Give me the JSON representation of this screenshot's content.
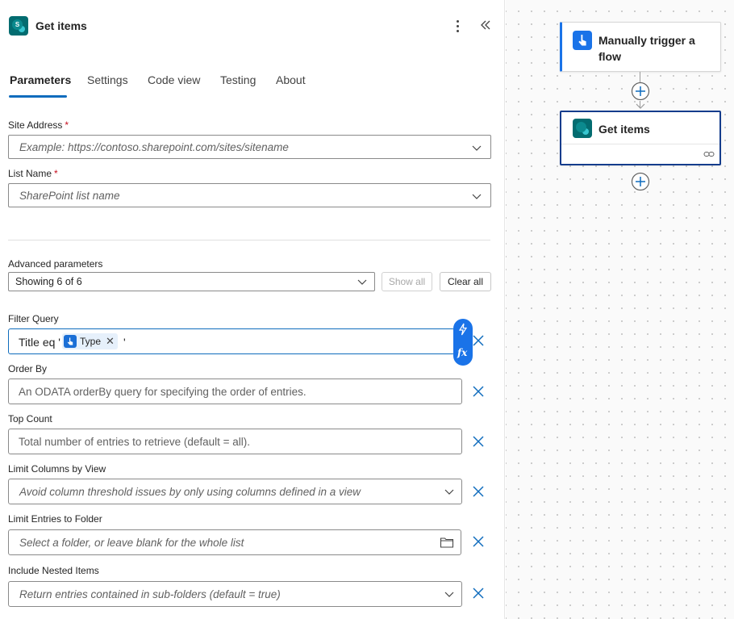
{
  "panel": {
    "title": "Get items",
    "tabs": [
      {
        "label": "Parameters",
        "active": true
      },
      {
        "label": "Settings",
        "active": false
      },
      {
        "label": "Code view",
        "active": false
      },
      {
        "label": "Testing",
        "active": false
      },
      {
        "label": "About",
        "active": false
      }
    ]
  },
  "fields": {
    "site_address": {
      "label": "Site Address",
      "required_mark": "*",
      "placeholder": "Example: https://contoso.sharepoint.com/sites/sitename"
    },
    "list_name": {
      "label": "List Name",
      "required_mark": "*",
      "placeholder": "SharePoint list name"
    }
  },
  "advanced": {
    "label": "Advanced parameters",
    "selected": "Showing 6 of 6",
    "show_all": "Show all",
    "clear_all": "Clear all"
  },
  "filter_query": {
    "label": "Filter Query",
    "prefix": "Title eq '",
    "token": "Type",
    "suffix": "'"
  },
  "params": [
    {
      "label": "Order By",
      "placeholder": "An ODATA orderBy query for specifying the order of entries."
    },
    {
      "label": "Top Count",
      "placeholder": "Total number of entries to retrieve (default = all)."
    },
    {
      "label": "Limit Columns by View",
      "placeholder": "Avoid column threshold issues by only using columns defined in a view"
    },
    {
      "label": "Limit Entries to Folder",
      "placeholder": "Select a folder, or leave blank for the whole list"
    },
    {
      "label": "Include Nested Items",
      "placeholder": "Return entries contained in sub-folders (default = true)"
    }
  ],
  "canvas": {
    "trigger_title": "Manually trigger a flow",
    "action_title": "Get items"
  },
  "dynamic": {
    "fx_label": "fx"
  },
  "colors": {
    "accent": "#0f6cbd",
    "trigger_blue": "#1a73e8",
    "sharepoint_teal": "#036c70",
    "selected_border": "#143c8c",
    "required": "#c50f1f"
  }
}
